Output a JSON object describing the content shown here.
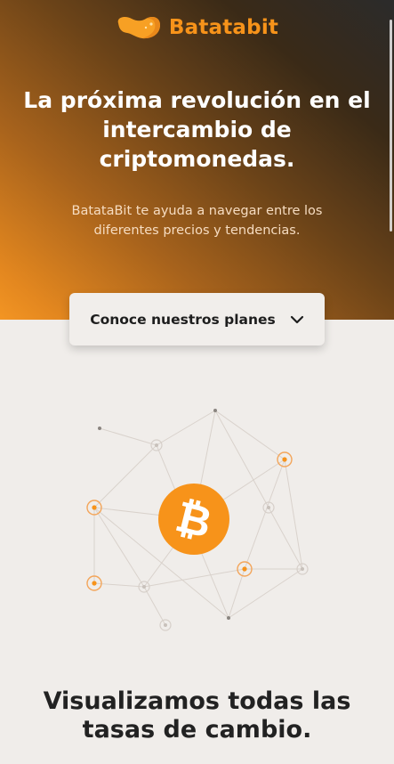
{
  "header": {
    "brand_name": "Batatabit",
    "logo_icon": "potato-logo-icon"
  },
  "hero": {
    "headline": "La próxima revolución en el intercambio de criptomonedas.",
    "subtitle": "BatataBit te ayuda a navegar entre los diferentes precios y tendencias.",
    "cta_label": "Conoce nuestros planes",
    "cta_icon": "chevron-down-icon"
  },
  "illustration": {
    "icon": "bitcoin-icon",
    "symbol": "₿"
  },
  "section": {
    "title": "Visualizamos todas las tasas de cambio."
  },
  "colors": {
    "accent": "#f7931a",
    "hero_dark": "#2b2b2b",
    "hero_light": "#f39523",
    "background": "#f0edea",
    "text_dark": "#222222"
  }
}
